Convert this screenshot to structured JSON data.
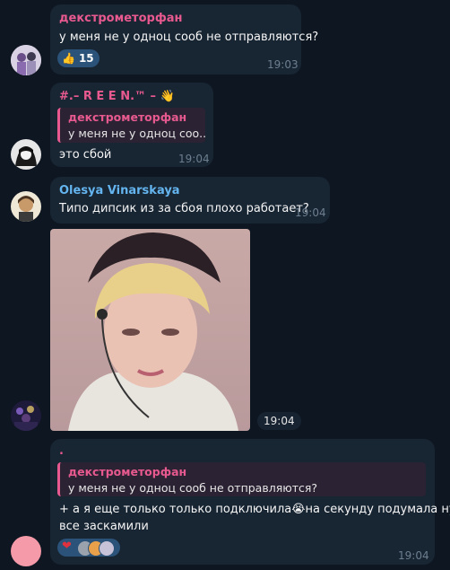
{
  "colors": {
    "background": "#0e1621",
    "bubble": "#182533",
    "pink_name": "#e85a8f",
    "blue_name": "#64b5ef",
    "time": "#6d7f8f"
  },
  "messages": [
    {
      "sender": "декстрометорфан",
      "text": "у меня не у одноц сооб не отправляются?",
      "reaction": {
        "icon": "thumbs-up-icon",
        "emoji": "👍",
        "count": "15"
      },
      "time": "19:03"
    },
    {
      "sender": "#.– R E E N.™ –",
      "sender_emoji": "👋",
      "reply": {
        "name": "декстрометорфан",
        "text": "у меня не у одноц соо..."
      },
      "text": "это сбой",
      "time": "19:04"
    },
    {
      "sender": "Olesya Vinarskaya",
      "text": "Типо дипсик из за сбоя плохо работает?",
      "time": "19:04"
    },
    {
      "type": "photo",
      "time": "19:04"
    },
    {
      "sender": ".",
      "reply": {
        "name": "декстрометорфан",
        "text": "у меня не у одноц сооб не отправляются?"
      },
      "text_line1_a": "+ а я еще только только подключила",
      "emoji": "😭",
      "text_line1_b": "на секунду подумала ну",
      "text_line2": "все заскамили",
      "reaction": {
        "icon": "heart-icon",
        "emoji": "❤"
      },
      "time": "19:04"
    }
  ]
}
